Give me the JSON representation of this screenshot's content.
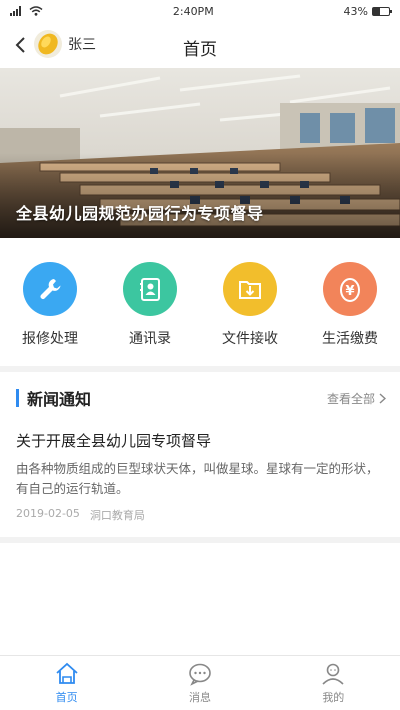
{
  "status_bar": {
    "time": "2:40PM",
    "battery": "43%",
    "battery_level": 0.43
  },
  "header": {
    "user_name": "张三",
    "title": "首页"
  },
  "banner": {
    "title": "全县幼儿园规范办园行为专项督导"
  },
  "quick_actions": [
    {
      "label": "报修处理",
      "icon": "wrench-icon",
      "color": "#3aa8f2"
    },
    {
      "label": "通讯录",
      "icon": "contacts-icon",
      "color": "#3cc6a0"
    },
    {
      "label": "文件接收",
      "icon": "folder-download-icon",
      "color": "#f2be2c"
    },
    {
      "label": "生活缴费",
      "icon": "yuan-icon",
      "color": "#f2845a"
    }
  ],
  "news": {
    "title": "新闻通知",
    "more_label": "查看全部",
    "article": {
      "title": "关于开展全县幼儿园专项督导",
      "desc": "由各种物质组成的巨型球状天体，叫做星球。星球有一定的形状，有自己的运行轨道。",
      "date": "2019-02-05",
      "source": "洞口教育局"
    }
  },
  "tabbar": {
    "items": [
      {
        "label": "首页"
      },
      {
        "label": "消息"
      },
      {
        "label": "我的"
      }
    ],
    "active_index": 0,
    "active_color": "#2f8bf0"
  }
}
